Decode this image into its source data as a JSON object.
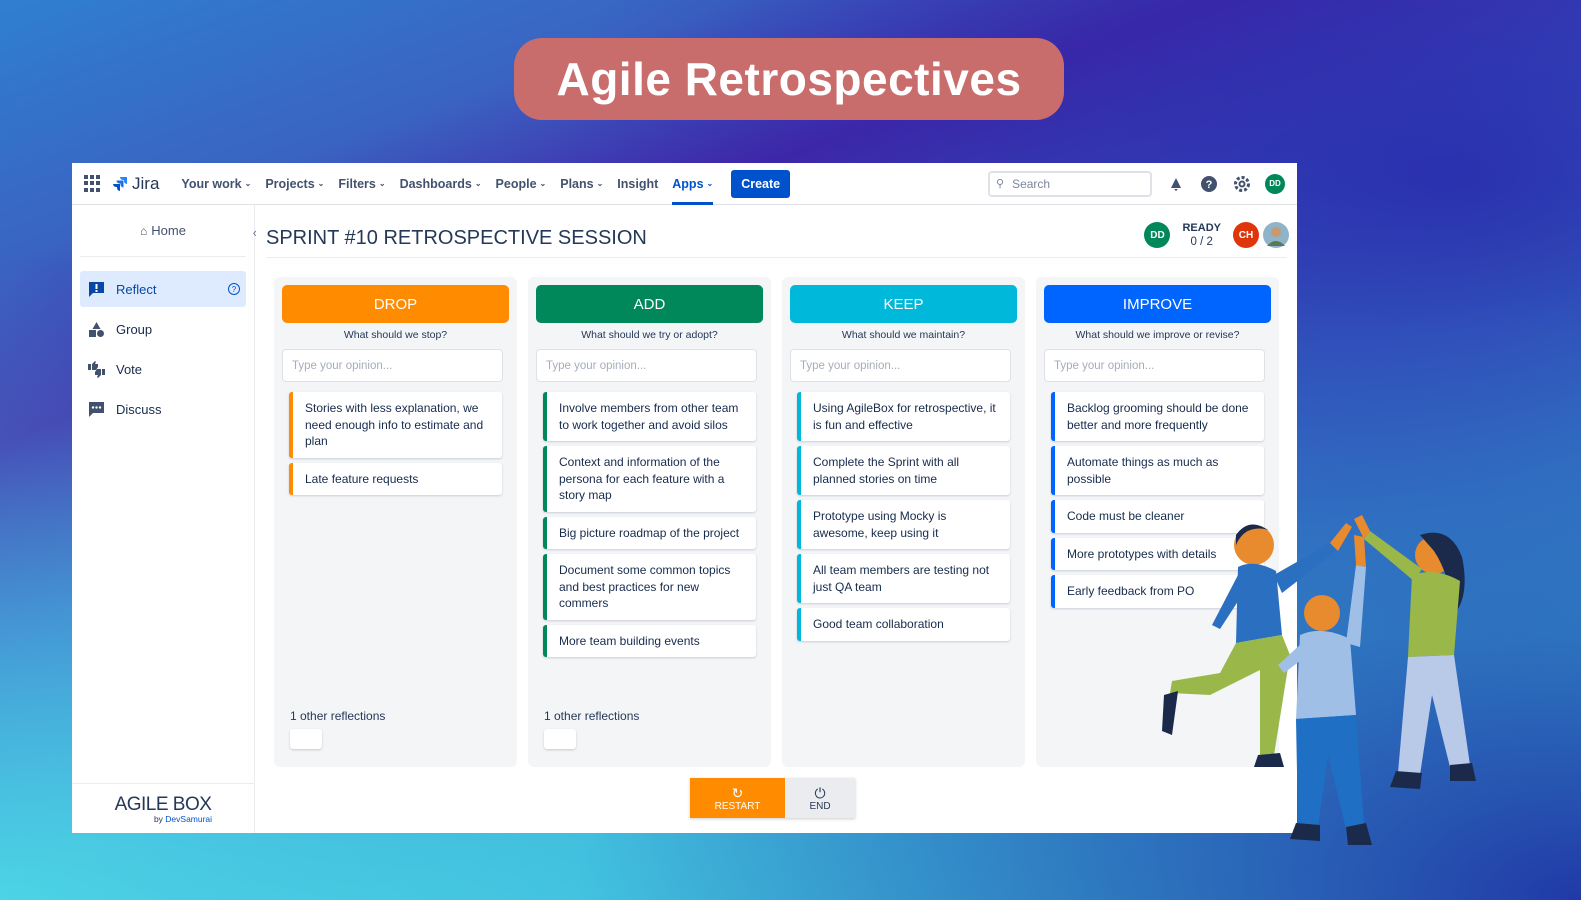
{
  "banner": {
    "title": "Agile Retrospectives"
  },
  "nav": {
    "logo": "Jira",
    "items": [
      {
        "label": "Your work",
        "chevron": true
      },
      {
        "label": "Projects",
        "chevron": true
      },
      {
        "label": "Filters",
        "chevron": true
      },
      {
        "label": "Dashboards",
        "chevron": true
      },
      {
        "label": "People",
        "chevron": true
      },
      {
        "label": "Plans",
        "chevron": true
      },
      {
        "label": "Insight",
        "chevron": false
      },
      {
        "label": "Apps",
        "chevron": true,
        "active": true
      }
    ],
    "create_label": "Create",
    "search_placeholder": "Search",
    "user_initials": "DD"
  },
  "sidebar": {
    "home_label": "Home",
    "items": [
      {
        "label": "Reflect",
        "icon": "exclamation-flag-icon",
        "active": true
      },
      {
        "label": "Group",
        "icon": "shapes-icon"
      },
      {
        "label": "Vote",
        "icon": "thumbs-icon"
      },
      {
        "label": "Discuss",
        "icon": "chat-icon"
      }
    ],
    "brand_name": "AGILE BOX",
    "brand_by": "by ",
    "brand_company": "DevSamurai"
  },
  "session": {
    "title": "SPRINT #10 RETROSPECTIVE SESSION",
    "ready_label": "READY",
    "ready_count": "0 / 2",
    "participants": [
      {
        "initials": "DD",
        "color": "#00875a"
      },
      {
        "initials": "CH",
        "color": "#de350b"
      }
    ]
  },
  "columns": [
    {
      "title": "DROP",
      "color": "#ff8b00",
      "subtitle": "What should we stop?",
      "placeholder": "Type your opinion...",
      "cards": [
        "Stories with less explanation, we need enough info to estimate and plan",
        "Late feature requests"
      ],
      "other": "1 other reflections"
    },
    {
      "title": "ADD",
      "color": "#00875a",
      "subtitle": "What should we try or adopt?",
      "placeholder": "Type your opinion...",
      "cards": [
        "Involve members from other team to work together and avoid silos",
        "Context and information of the persona for each feature with a story map",
        "Big picture roadmap of the project",
        "Document some common topics and best practices for new commers",
        "More team building events"
      ],
      "other": "1 other reflections"
    },
    {
      "title": "KEEP",
      "color": "#00b8d9",
      "subtitle": "What should we maintain?",
      "placeholder": "Type your opinion...",
      "cards": [
        "Using AgileBox for retrospective, it is fun and effective",
        "Complete the Sprint with all planned stories on time",
        "Prototype using Mocky is awesome, keep using it",
        "All team members are testing not just QA team",
        "Good team collaboration"
      ],
      "other": ""
    },
    {
      "title": "IMPROVE",
      "color": "#0065ff",
      "subtitle": "What should we improve or revise?",
      "placeholder": "Type your opinion...",
      "cards": [
        "Backlog grooming should be done better and more frequently",
        "Automate things as much as possible",
        "Code must be cleaner",
        "More prototypes with details",
        "Early feedback from PO"
      ],
      "other": ""
    }
  ],
  "controls": {
    "restart": "RESTART",
    "end": "END"
  }
}
